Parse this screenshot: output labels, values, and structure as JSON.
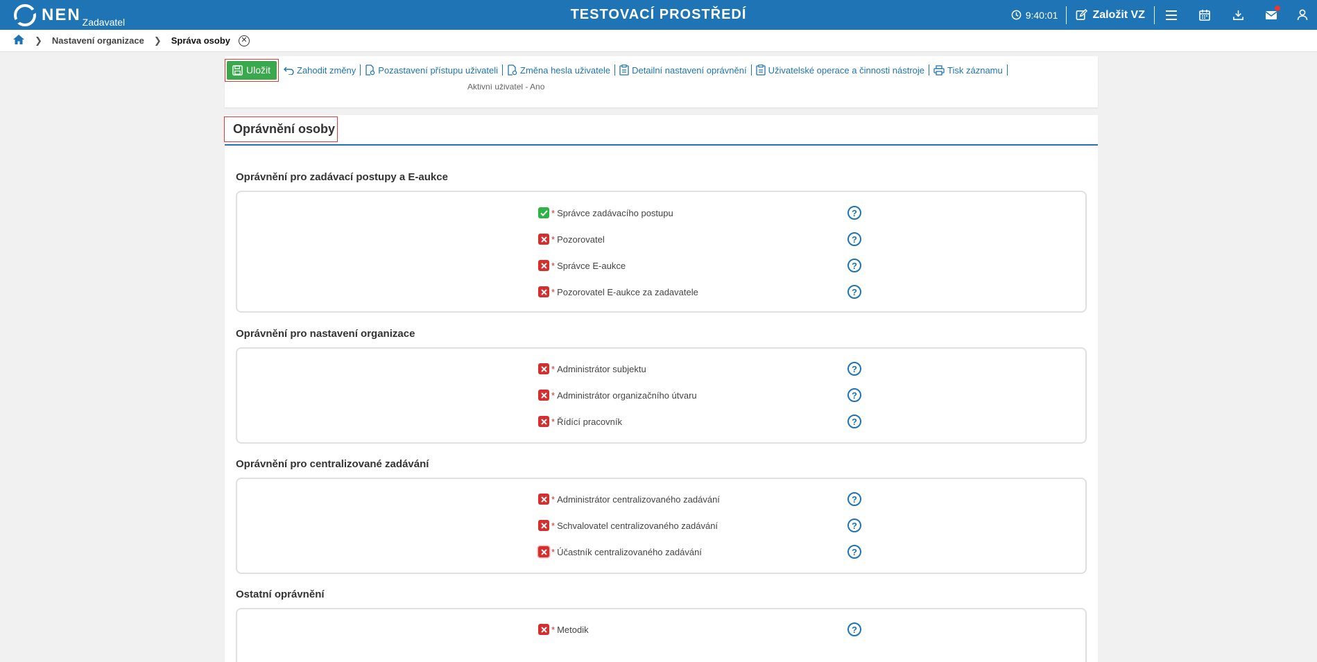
{
  "header": {
    "logo_text": "NEN",
    "logo_sub": "Zadavatel",
    "environment_title": "TESTOVACÍ PROSTŘEDÍ",
    "clock": "9:40:01",
    "create_label": "Založit VZ",
    "icons": [
      "menu-icon",
      "calendar-icon",
      "download-icon",
      "mail-icon",
      "user-icon"
    ],
    "accent_color": "#1f74b5"
  },
  "breadcrumb": {
    "items": [
      "Nastavení organizace"
    ],
    "current": "Správa osoby"
  },
  "toolbar": {
    "save_label": "Uložit",
    "links": [
      "Zahodit změny",
      "Pozastavení přístupu uživateli",
      "Změna hesla uživatele",
      "Detailní nastavení oprávnění",
      "Uživatelské operace a činnosti nástroje",
      "Tisk záznamu"
    ]
  },
  "previous_section": {
    "partial_text": "Aktivní uživatel - Ano"
  },
  "permissions_panel": {
    "title": "Oprávnění osoby",
    "sections": [
      {
        "title": "Oprávnění pro zadávací postupy a E-aukce",
        "items": [
          {
            "label": "Správce zadávacího postupu",
            "granted": true
          },
          {
            "label": "Pozorovatel",
            "granted": false
          },
          {
            "label": "Správce E-aukce",
            "granted": false
          },
          {
            "label": "Pozorovatel E-aukce za zadavatele",
            "granted": false
          }
        ]
      },
      {
        "title": "Oprávnění pro nastavení organizace",
        "items": [
          {
            "label": "Administrátor subjektu",
            "granted": false
          },
          {
            "label": "Administrátor organizačního útvaru",
            "granted": false
          },
          {
            "label": "Řídící pracovník",
            "granted": false
          }
        ]
      },
      {
        "title": "Oprávnění pro centralizované zadávání",
        "items": [
          {
            "label": "Administrátor centralizovaného zadávání",
            "granted": false
          },
          {
            "label": "Schvalovatel centralizovaného zadávání",
            "granted": false
          },
          {
            "label": "Účastník centralizovaného zadávání",
            "granted": false
          }
        ]
      },
      {
        "title": "Ostatní oprávnění",
        "items": [
          {
            "label": "Metodik",
            "granted": false
          }
        ]
      }
    ]
  }
}
